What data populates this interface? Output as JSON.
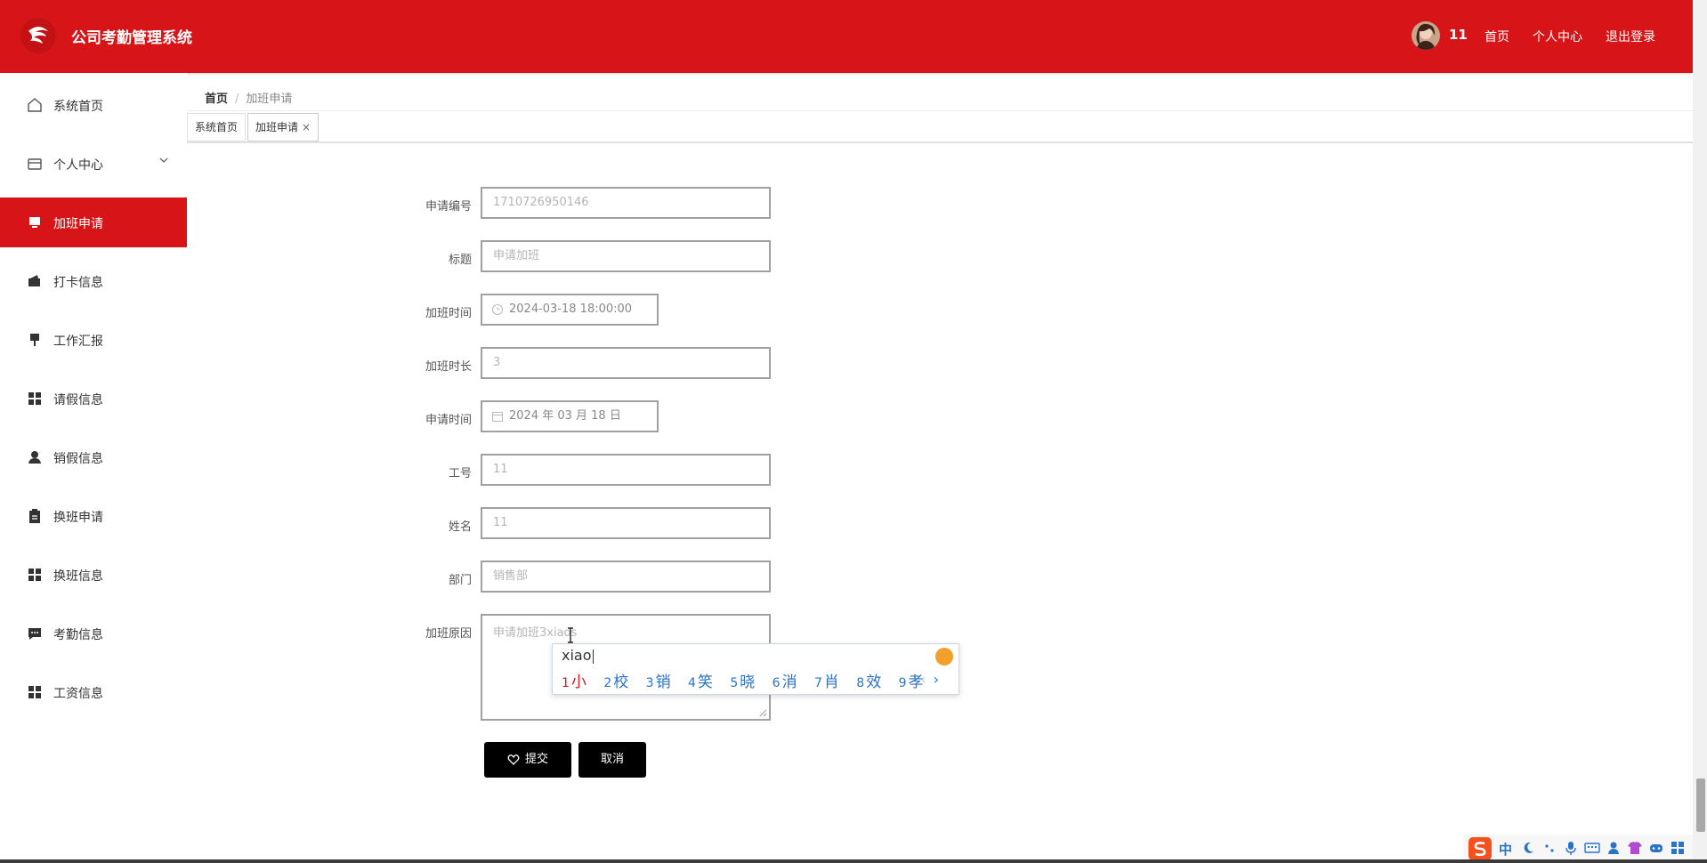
{
  "header": {
    "app_title": "公司考勤管理系统",
    "user_name": "11",
    "nav": {
      "home": "首页",
      "profile": "个人中心",
      "logout": "退出登录"
    },
    "accent_color": "#d71518"
  },
  "sidebar": {
    "items": [
      {
        "label": "系统首页",
        "icon": "home-icon"
      },
      {
        "label": "个人中心",
        "icon": "card-icon"
      },
      {
        "label": "加班申请",
        "icon": "monitor-icon",
        "active": true
      },
      {
        "label": "打卡信息",
        "icon": "wallet-icon"
      },
      {
        "label": "工作汇报",
        "icon": "brush-icon"
      },
      {
        "label": "请假信息",
        "icon": "grid-icon"
      },
      {
        "label": "销假信息",
        "icon": "user-icon"
      },
      {
        "label": "换班申请",
        "icon": "clipboard-icon"
      },
      {
        "label": "换班信息",
        "icon": "grid-icon"
      },
      {
        "label": "考勤信息",
        "icon": "chat-icon"
      },
      {
        "label": "工资信息",
        "icon": "grid-icon"
      }
    ]
  },
  "breadcrumb": {
    "home": "首页",
    "sep": "/",
    "current": "加班申请"
  },
  "tabs": [
    {
      "label": "系统首页"
    },
    {
      "label": "加班申请",
      "close": "×"
    }
  ],
  "form": {
    "fields": [
      {
        "label": "申请编号",
        "value": "1710726950146"
      },
      {
        "label": "标题",
        "value": "申请加班"
      },
      {
        "label": "加班时间",
        "value": "2024-03-18 18:00:00",
        "icon": "clock-icon"
      },
      {
        "label": "加班时长",
        "value": "3"
      },
      {
        "label": "申请时间",
        "value": "2024 年 03 月 18 日",
        "icon": "calendar-icon"
      },
      {
        "label": "工号",
        "value": "11"
      },
      {
        "label": "姓名",
        "value": "11"
      },
      {
        "label": "部门",
        "value": "销售部"
      }
    ],
    "reason_label": "加班原因",
    "reason_value": "申请加班3xiaos",
    "submit_label": "提交",
    "cancel_label": "取消"
  },
  "ime": {
    "input": "xiao",
    "candidates": [
      {
        "n": "1",
        "c": "小"
      },
      {
        "n": "2",
        "c": "校"
      },
      {
        "n": "3",
        "c": "销"
      },
      {
        "n": "4",
        "c": "笑"
      },
      {
        "n": "5",
        "c": "晓"
      },
      {
        "n": "6",
        "c": "消"
      },
      {
        "n": "7",
        "c": "肖"
      },
      {
        "n": "8",
        "c": "效"
      },
      {
        "n": "9",
        "c": "孝"
      }
    ],
    "prev": "‹",
    "next": "›"
  },
  "tray": {
    "lang": "中"
  }
}
